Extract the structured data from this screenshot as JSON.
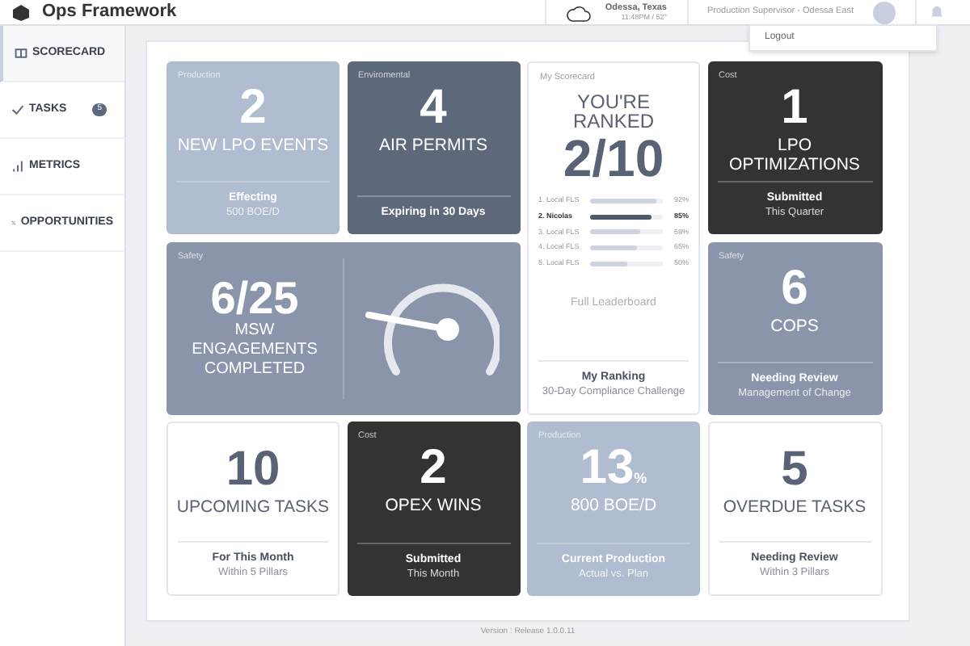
{
  "header": {
    "title": "Ops Framework",
    "location": "Odessa, Texas",
    "weather": "11:48PM / 52°",
    "role": "Production Supervisor - Odessa East"
  },
  "user_menu": {
    "items": [
      "Logout"
    ]
  },
  "sidebar": {
    "items": [
      {
        "label": "SCORECARD",
        "kind": "scorecard",
        "selected": true
      },
      {
        "label": "TASKS",
        "kind": "tasks",
        "badge": "5",
        "selected": false
      },
      {
        "label": "METRICS",
        "kind": "metrics",
        "selected": false
      },
      {
        "label": "OPPORTUNITIES",
        "kind": "opportunities",
        "selected": false
      }
    ]
  },
  "cards": [
    {
      "kind": "stat",
      "category": "Production",
      "color": "#b0bccf",
      "number": "2",
      "title": "NEW LPO EVENTS",
      "footer_bold": "Effecting",
      "footer": "500 BOE/D"
    },
    {
      "kind": "stat",
      "category": "Enviromental",
      "color": "#5d687b",
      "number": "4",
      "title": "AIR PERMITS",
      "footer_bold": "Expiring in 30 Days"
    },
    {
      "kind": "scorecard",
      "category": "My Scorecard",
      "color": "#ffffff",
      "title": "YOU'RE RANKED",
      "number": "2/10",
      "ranks": [
        {
          "name": "1. Local FLS",
          "level": 0.92,
          "reading": "92%",
          "selected": false
        },
        {
          "name": "2. Nicolas",
          "level": 0.85,
          "reading": "85%",
          "selected": true
        },
        {
          "name": "3. Local FLS",
          "level": 0.69,
          "reading": "69%",
          "selected": false
        },
        {
          "name": "4. Local FLS",
          "level": 0.65,
          "reading": "65%",
          "selected": false
        },
        {
          "name": "5. Local FLS",
          "level": 0.5,
          "reading": "50%",
          "selected": false
        }
      ],
      "link": "Full Leaderboard",
      "footer_bold": "My Ranking",
      "footer": "30-Day Compliance Challenge"
    },
    {
      "kind": "stat",
      "category": "Cost",
      "color": "#333333",
      "number": "1",
      "title": "LPO OPTIMIZATIONS",
      "footer_bold": "Submitted",
      "footer": "This Quarter"
    },
    {
      "kind": "gauge",
      "category": "Safety",
      "color": "#8a95ab",
      "number": "6/25",
      "title": "MSW ENGAGEMENTS COMPLETED"
    },
    {
      "kind": "stat",
      "category": "Safety",
      "color": "#8a95ab",
      "number": "6",
      "title": "COPS",
      "footer_bold": "Needing Review",
      "footer": "Management of Change"
    },
    {
      "kind": "stat",
      "color": "#ffffff",
      "number": "10",
      "title": "UPCOMING TASKS",
      "footer_bold": "For This Month",
      "footer": "Within 5 Pillars"
    },
    {
      "kind": "stat",
      "category": "Cost",
      "color": "#333333",
      "number": "2",
      "title": "OPEX WINS",
      "footer_bold": "Submitted",
      "footer": "This Month"
    },
    {
      "kind": "stat",
      "category": "Production",
      "color": "#b0bccf",
      "number": "13",
      "unit": "%",
      "title": "800 BOE/D",
      "footer_bold": "Current Production",
      "footer": "Actual vs. Plan"
    },
    {
      "kind": "stat",
      "color": "#ffffff",
      "number": "5",
      "title": "OVERDUE TASKS",
      "footer_bold": "Needing Review",
      "footer": "Within 3 Pillars"
    }
  ],
  "footer": {
    "version": "Version : Release 1.0.0.11"
  }
}
